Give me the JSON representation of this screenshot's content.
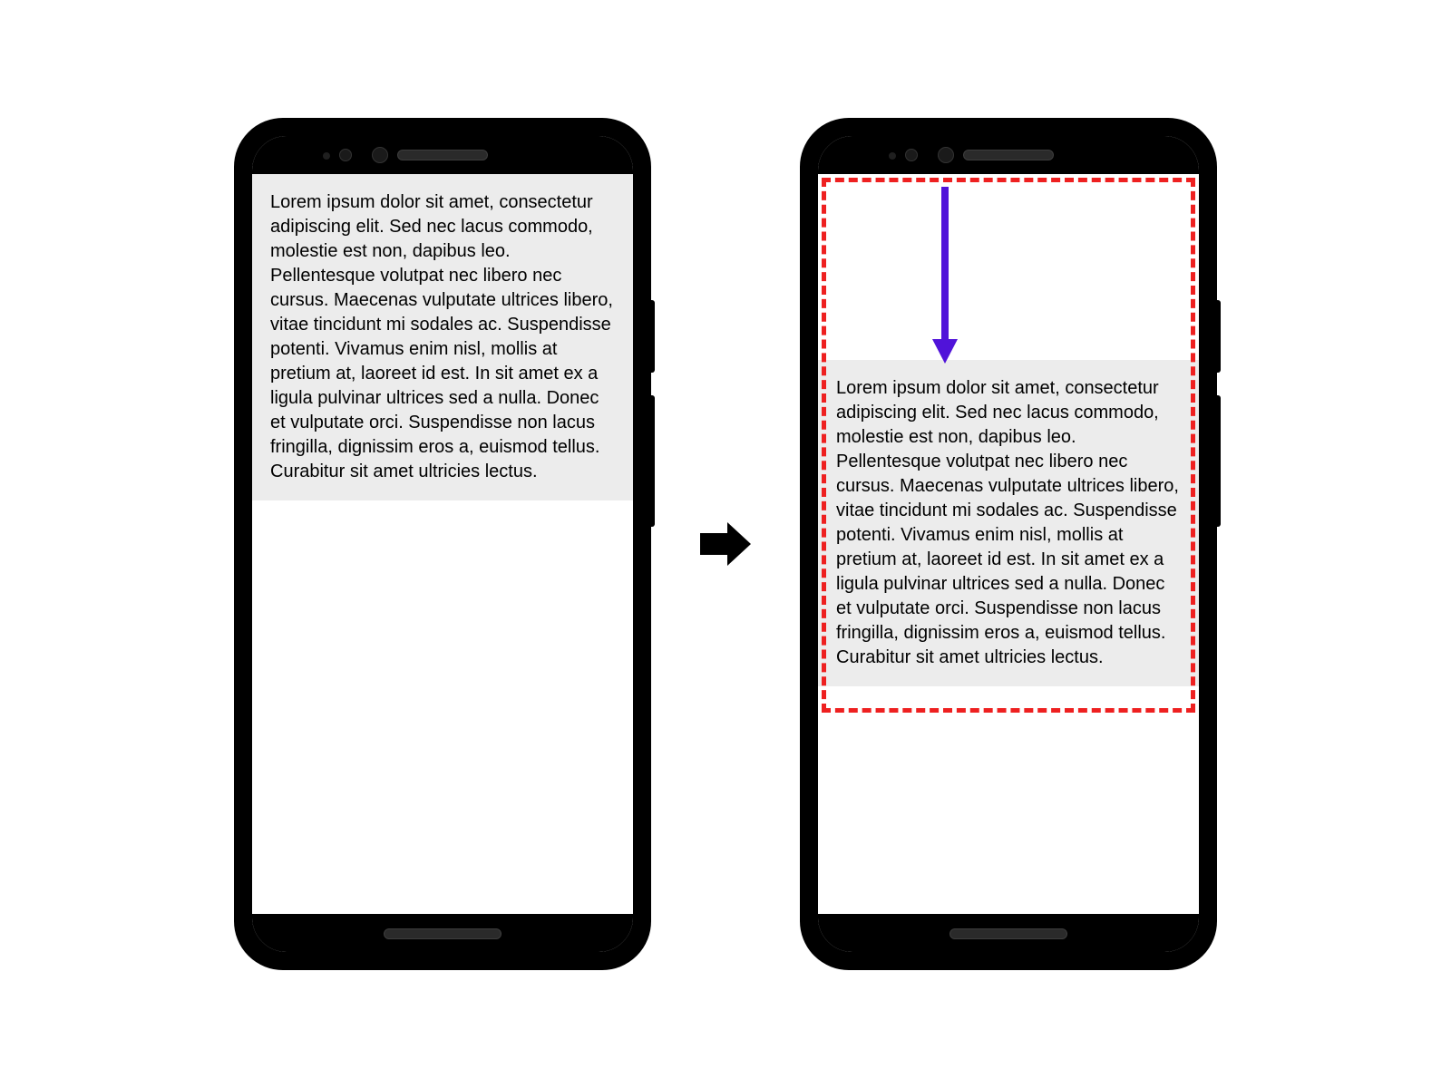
{
  "diagram": {
    "lorem_text": "Lorem ipsum dolor sit amet, consectetur adipiscing elit. Sed nec lacus commodo, molestie est non, dapibus leo. Pellentesque volutpat nec libero nec cursus. Maecenas vulputate ultrices libero, vitae tincidunt mi sodales ac. Suspendisse potenti. Vivamus enim nisl, mollis at pretium at, laoreet id est. In sit amet ex a ligula pulvinar ultrices sed a nulla. Donec et vulputate orci. Suspendisse non lacus fringilla, dignissim eros a, euismod tellus. Curabitur sit amet ultricies lectus.",
    "annotation": {
      "highlight_border_color": "#ee2020",
      "offset_arrow_color": "#5013d9"
    }
  }
}
